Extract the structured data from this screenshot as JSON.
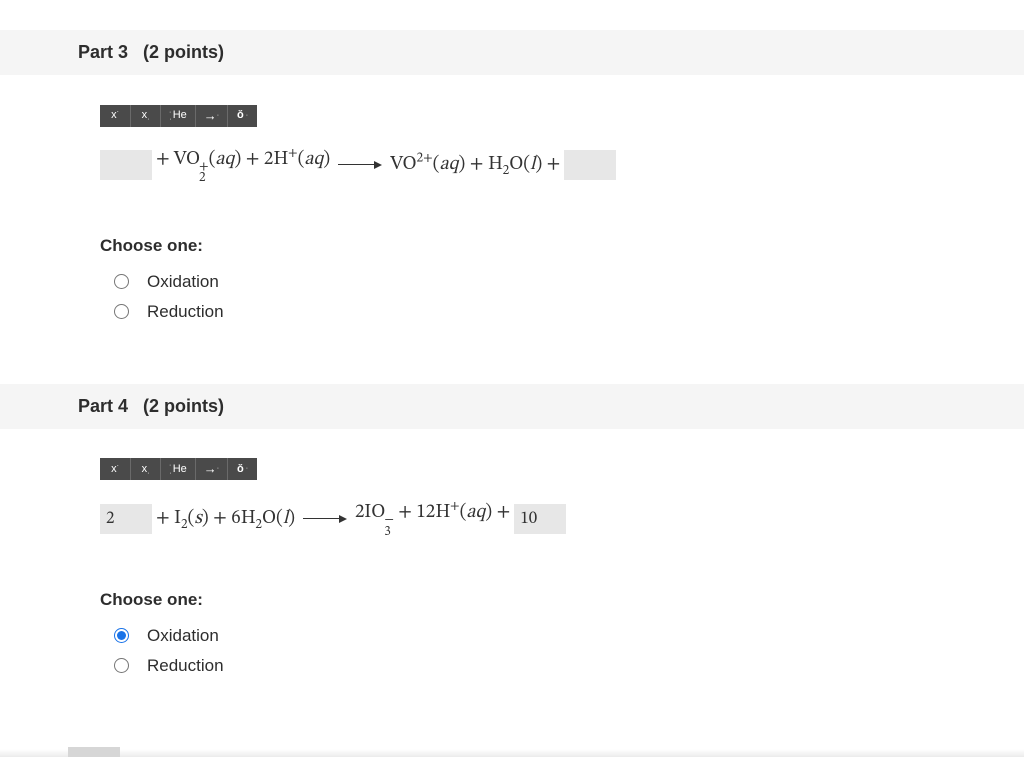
{
  "parts": [
    {
      "id": "part3",
      "header_label": "Part 3",
      "points_label": "(2 points)",
      "toolbar": {
        "xsup": "x",
        "xsub": "x",
        "element": "He",
        "arrow": "arrow",
        "sigma": "sigma"
      },
      "equation": {
        "input_left": "",
        "mid_html": "+ VO<span class=\"supsub\"><span>+</span><span>2</span></span>(<i>aq</i>) + 2H<sup>+</sup>(<i>aq</i>)",
        "rhs_html": "VO<sup>2+</sup>(<i>aq</i>) + H<sub>2</sub>O(<i>l</i>) +",
        "input_right": ""
      },
      "choose_label": "Choose one:",
      "options": [
        {
          "label": "Oxidation",
          "selected": false
        },
        {
          "label": "Reduction",
          "selected": false
        }
      ]
    },
    {
      "id": "part4",
      "header_label": "Part 4",
      "points_label": "(2 points)",
      "toolbar": {
        "xsup": "x",
        "xsub": "x",
        "element": "He",
        "arrow": "arrow",
        "sigma": "sigma"
      },
      "equation": {
        "input_left": "2",
        "mid_html": "+ I<sub>2</sub>(<i>s</i>) + 6H<sub>2</sub>O(<i>l</i>)",
        "rhs_html": "2IO<span class=\"supsub\"><span>−</span><span>3</span></span> + 12H<sup>+</sup>(<i>aq</i>) + ",
        "input_right": "10"
      },
      "choose_label": "Choose one:",
      "options": [
        {
          "label": "Oxidation",
          "selected": true
        },
        {
          "label": "Reduction",
          "selected": false
        }
      ]
    }
  ]
}
